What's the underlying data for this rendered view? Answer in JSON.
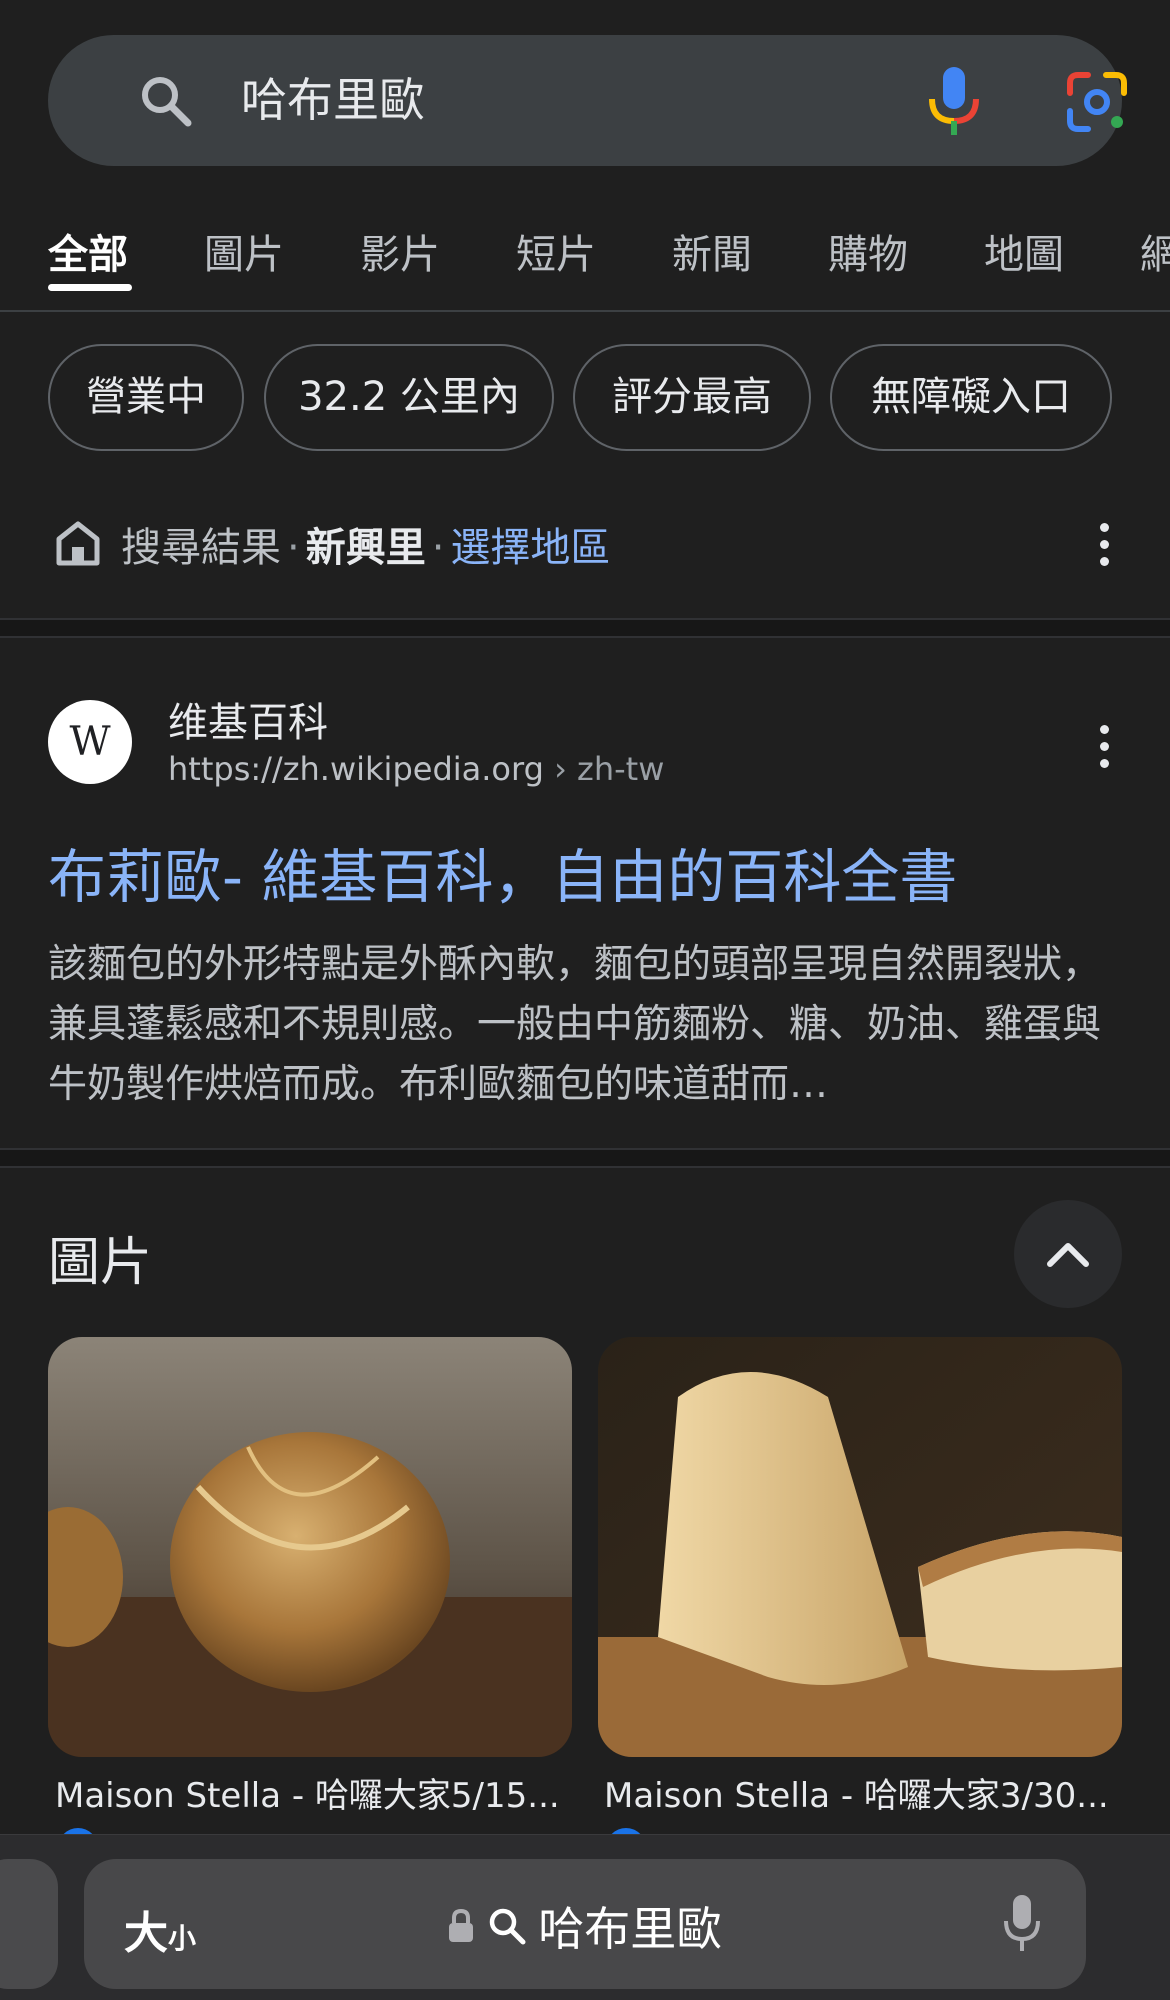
{
  "search": {
    "query": "哈布里歐"
  },
  "tabs": [
    "全部",
    "圖片",
    "影片",
    "短片",
    "新聞",
    "購物",
    "地圖",
    "網"
  ],
  "chips": [
    "營業中",
    "32.2 公里內",
    "評分最高",
    "無障礙入口"
  ],
  "location": {
    "prefix": "搜尋結果",
    "place": "新興里",
    "choose_link": "選擇地區"
  },
  "result": {
    "logo_letter": "W",
    "site_name": "维基百科",
    "url": "https://zh.wikipedia.org",
    "url_path": "› zh-tw",
    "title": "布莉歐- 維基百科，自由的百科全書",
    "snippet": "該麵包的外形特點是外酥內軟，麵包的頭部呈現自然開裂狀，兼具蓬鬆感和不規則感。一般由中筋麵粉、糖、奶油、雞蛋與牛奶製作烘焙而成。布利歐麵包的味道甜而…"
  },
  "images": {
    "heading": "圖片",
    "items": [
      {
        "caption": "Maison Stella - 哈囉大家5/15..."
      },
      {
        "caption": "Maison Stella - 哈囉大家3/30..."
      }
    ]
  },
  "browser_bar": {
    "text_size_big": "大",
    "text_size_small": "小",
    "query": "哈布里歐"
  }
}
